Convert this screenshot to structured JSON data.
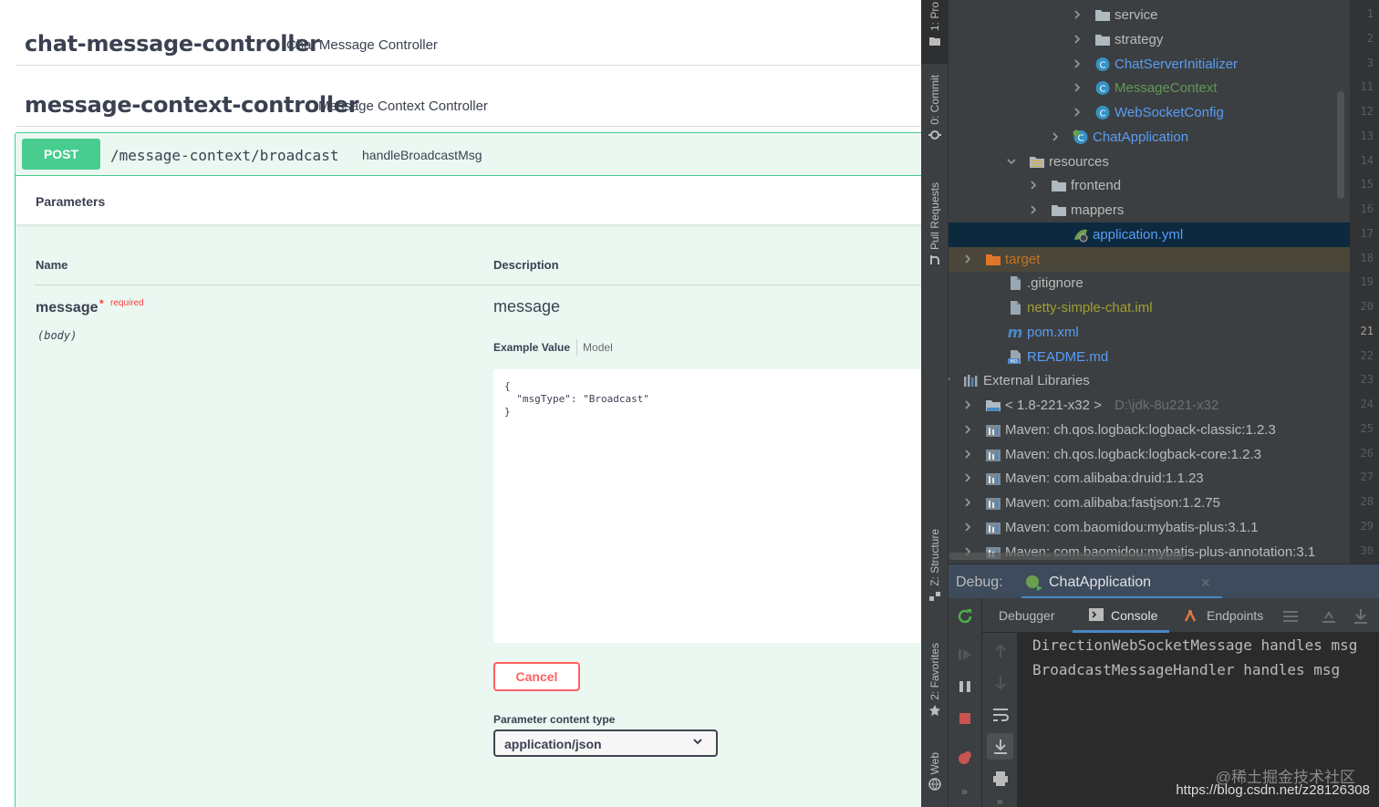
{
  "swagger": {
    "controllers": [
      {
        "name": "chat-message-controller",
        "description": "Chat Message Controller"
      },
      {
        "name": "message-context-controller",
        "description": "Message Context Controller"
      }
    ],
    "operation": {
      "method": "POST",
      "path": "/message-context/broadcast",
      "operation_id": "handleBroadcastMsg",
      "parameters_title": "Parameters",
      "col_name": "Name",
      "col_description": "Description",
      "param": {
        "name": "message",
        "required_star": "*",
        "required_label": "required",
        "location": "(body)",
        "description": "message"
      },
      "example_tabs": {
        "example": "Example Value",
        "model": "Model"
      },
      "body_value": "{\n  \"msgType\": \"Broadcast\"\n}",
      "cancel_label": "Cancel",
      "content_type_label": "Parameter content type",
      "content_type_value": "application/json"
    },
    "colors": {
      "post": "#49cc90",
      "cancel": "#ff6060"
    }
  },
  "ide": {
    "stripe_tabs": [
      "1: Pro",
      "0: Commit",
      "Pull Requests",
      "Z: Structure",
      "2: Favorites",
      "Web"
    ],
    "tree": [
      {
        "label": "service",
        "icon": "folder-icon",
        "color": "#bbbbbb"
      },
      {
        "label": "strategy",
        "icon": "folder-icon",
        "color": "#bbbbbb"
      },
      {
        "label": "ChatServerInitializer",
        "icon": "class-icon",
        "color": "#589df6"
      },
      {
        "label": "MessageContext",
        "icon": "class-icon",
        "color": "#629755"
      },
      {
        "label": "WebSocketConfig",
        "icon": "class-icon",
        "color": "#589df6"
      },
      {
        "label": "ChatApplication",
        "icon": "spring-class-icon",
        "color": "#589df6"
      },
      {
        "label": "resources",
        "icon": "resources-folder-icon",
        "color": "#bbbbbb"
      },
      {
        "label": "frontend",
        "icon": "folder-icon",
        "color": "#bbbbbb"
      },
      {
        "label": "mappers",
        "icon": "folder-icon",
        "color": "#bbbbbb"
      },
      {
        "label": "application.yml",
        "icon": "spring-yml-icon",
        "color": "#589df6"
      },
      {
        "label": "target",
        "icon": "excluded-folder-icon",
        "color": "#c27426"
      },
      {
        "label": ".gitignore",
        "icon": "file-icon",
        "color": "#bbbbbb"
      },
      {
        "label": "netty-simple-chat.iml",
        "icon": "file-icon",
        "color": "#a0a031"
      },
      {
        "label": "pom.xml",
        "icon": "maven-icon",
        "color": "#589df6"
      },
      {
        "label": "README.md",
        "icon": "markdown-icon",
        "color": "#589df6"
      },
      {
        "label": "External Libraries",
        "icon": "libraries-icon",
        "color": "#bbbbbb"
      },
      {
        "label": "< 1.8-221-x32 >",
        "suffix": "D:\\jdk-8u221-x32",
        "icon": "jdk-folder-icon",
        "color": "#bbbbbb"
      },
      {
        "label": "Maven: ch.qos.logback:logback-classic:1.2.3",
        "icon": "library-icon",
        "color": "#bbbbbb"
      },
      {
        "label": "Maven: ch.qos.logback:logback-core:1.2.3",
        "icon": "library-icon",
        "color": "#bbbbbb"
      },
      {
        "label": "Maven: com.alibaba:druid:1.1.23",
        "icon": "library-icon",
        "color": "#bbbbbb"
      },
      {
        "label": "Maven: com.alibaba:fastjson:1.2.75",
        "icon": "library-icon",
        "color": "#bbbbbb"
      },
      {
        "label": "Maven: com.baomidou:mybatis-plus:3.1.1",
        "icon": "library-icon",
        "color": "#bbbbbb"
      },
      {
        "label": "Maven: com.baomidou:mybatis-plus-annotation:3.1",
        "icon": "library-icon",
        "color": "#bbbbbb"
      }
    ],
    "line_numbers": [
      "1",
      "2",
      "3",
      "11",
      "12",
      "13",
      "14",
      "15",
      "16",
      "17",
      "18",
      "19",
      "20",
      "21",
      "22",
      "23",
      "24",
      "25",
      "26",
      "27",
      "28",
      "29",
      "30"
    ],
    "debug": {
      "title": "Debug:",
      "run_config": "ChatApplication",
      "tabs": [
        "Debugger",
        "Console",
        "Endpoints"
      ],
      "console_lines": [
        "DirectionWebSocketMessage handles msg",
        "BroadcastMessageHandler handles msg"
      ]
    },
    "watermark": "@稀土掘金技术社区",
    "watermark_url": "https://blog.csdn.net/z28126308"
  }
}
